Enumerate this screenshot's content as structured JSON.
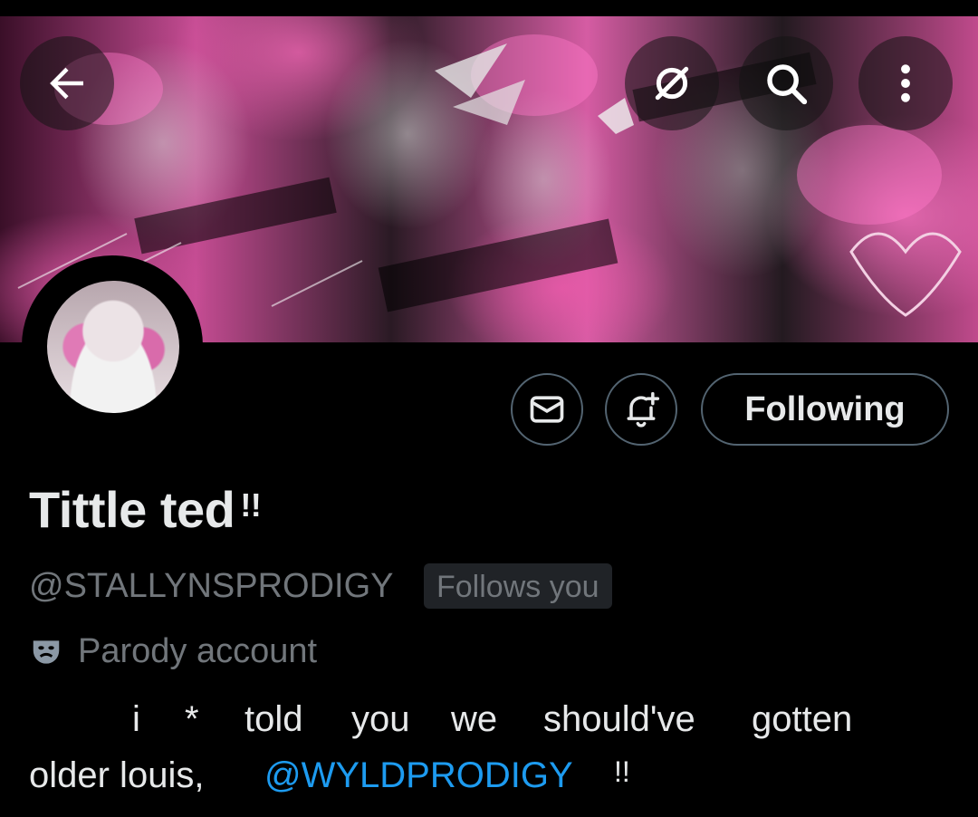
{
  "header": {
    "back_icon": "arrow-left-icon",
    "grok_icon": "grok-slash-circle-icon",
    "search_icon": "search-icon",
    "more_icon": "more-vertical-icon"
  },
  "profile": {
    "display_name": "Tittle ted",
    "display_name_suffix": "!!",
    "handle": "@STALLYNSPRODIGY",
    "follows_you": "Follows you",
    "label": "Parody account",
    "label_icon": "theater-mask-icon",
    "bio": {
      "words_line1": [
        "i",
        "*",
        "told",
        "you",
        "we",
        "should've",
        "gotten"
      ],
      "line2_text": "older louis,",
      "mention": "@WYLDPRODIGY",
      "line2_suffix": "!!"
    }
  },
  "actions": {
    "message_icon": "mail-icon",
    "notify_icon": "bell-plus-icon",
    "following_label": "Following"
  },
  "colors": {
    "background": "#000000",
    "text_primary": "#e7e9ea",
    "text_secondary": "#71767b",
    "link": "#1d9bf0",
    "border": "#536471",
    "badge_bg": "#202327",
    "banner_pink": "#d55ca3"
  }
}
